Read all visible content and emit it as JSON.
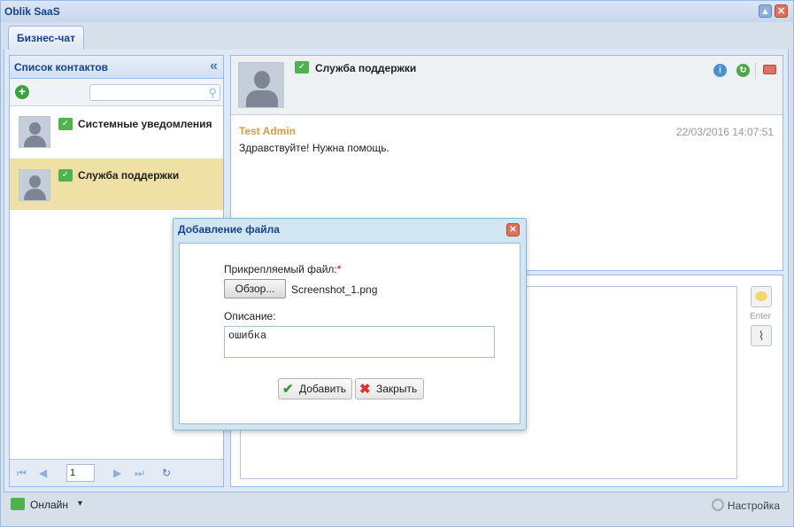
{
  "app": {
    "title": "Oblik SaaS"
  },
  "tabs": [
    {
      "label": "Бизнес-чат"
    }
  ],
  "contacts_panel": {
    "title": "Список контактов",
    "items": [
      {
        "name": "Системные уведомления",
        "selected": false
      },
      {
        "name": "Служба поддержки",
        "selected": true
      }
    ],
    "pager": {
      "page": "1"
    }
  },
  "chat": {
    "contact_name": "Служба поддержки",
    "messages": [
      {
        "author": "Test Admin",
        "time": "22/03/2016 14:07:51",
        "text": "Здравствуйте! Нужна помощь."
      }
    ],
    "enter_label": "Enter"
  },
  "status": {
    "online_label": "Онлайн",
    "settings_label": "Настройка"
  },
  "dialog": {
    "title": "Добавление файла",
    "file_label": "Прикрепляемый файл:",
    "required_mark": "*",
    "browse_label": "Обзор...",
    "file_name": "Screenshot_1.png",
    "description_label": "Описание:",
    "description_value": "ошибка",
    "add_label": "Добавить",
    "close_label": "Закрыть"
  },
  "colors": {
    "accent": "#15428b",
    "selected_row": "#efe0a6",
    "author": "#e49a3a",
    "online": "#4db34d"
  }
}
